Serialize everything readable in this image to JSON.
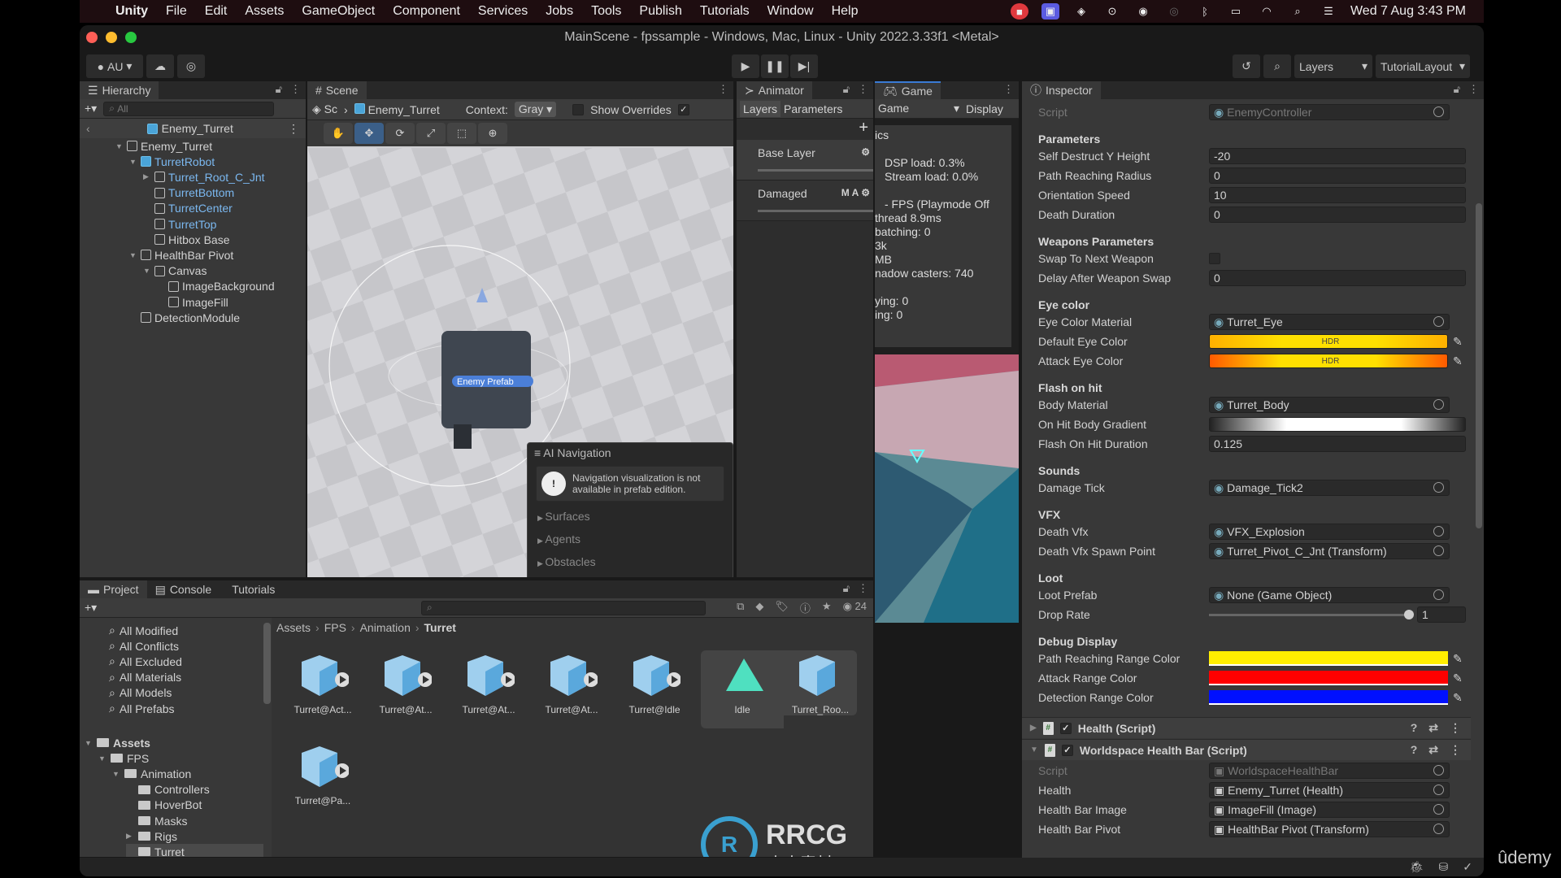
{
  "menubar": {
    "app": "Unity",
    "items": [
      "File",
      "Edit",
      "Assets",
      "GameObject",
      "Component",
      "Services",
      "Jobs",
      "Tools",
      "Publish",
      "Tutorials",
      "Window",
      "Help"
    ],
    "clock": "Wed 7 Aug  3:43 PM"
  },
  "window": {
    "title": "MainScene - fpssample - Windows, Mac, Linux - Unity 2022.3.33f1 <Metal>"
  },
  "toolbar": {
    "account": "AU",
    "layers": "Layers",
    "layout": "TutorialLayout"
  },
  "hierarchy": {
    "tab": "Hierarchy",
    "search_placeholder": "All",
    "prefab_root": "Enemy_Turret",
    "items": [
      {
        "label": "Enemy_Turret",
        "depth": 0,
        "expanded": true,
        "blue": false
      },
      {
        "label": "TurretRobot",
        "depth": 1,
        "expanded": true,
        "blue": true
      },
      {
        "label": "Turret_Root_C_Jnt",
        "depth": 2,
        "expanded": false,
        "blue": true,
        "arrow": true
      },
      {
        "label": "TurretBottom",
        "depth": 2,
        "blue": true
      },
      {
        "label": "TurretCenter",
        "depth": 2,
        "blue": true
      },
      {
        "label": "TurretTop",
        "depth": 2,
        "blue": true
      },
      {
        "label": "Hitbox Base",
        "depth": 2,
        "blue": false
      },
      {
        "label": "HealthBar Pivot",
        "depth": 1,
        "expanded": true,
        "blue": false
      },
      {
        "label": "Canvas",
        "depth": 2,
        "expanded": true,
        "blue": false
      },
      {
        "label": "ImageBackground",
        "depth": 3,
        "blue": false
      },
      {
        "label": "ImageFill",
        "depth": 3,
        "blue": false
      },
      {
        "label": "DetectionModule",
        "depth": 1,
        "blue": false
      }
    ]
  },
  "scene": {
    "tab": "Scene",
    "breadcrumb_root": "Sc",
    "breadcrumb_item": "Enemy_Turret",
    "context_label": "Context:",
    "context_value": "Gray",
    "show_overrides": "Show Overrides",
    "prefab_label": "Enemy Prefab",
    "ai_nav": {
      "title": "AI Navigation",
      "message": "Navigation visualization is not available in prefab edition.",
      "items": [
        "Surfaces",
        "Agents",
        "Obstacles"
      ]
    }
  },
  "animator": {
    "tab": "Animator",
    "subtabs": [
      "Layers",
      "Parameters"
    ],
    "layers": [
      {
        "name": "Base Layer",
        "badges": ""
      },
      {
        "name": "Damaged",
        "badges": "M A"
      }
    ]
  },
  "game": {
    "tab": "Game",
    "display_select": "Game",
    "display": "Display",
    "stats": [
      "ics",
      "",
      "DSP load: 0.3%",
      "Stream load: 0.0%",
      "",
      "- FPS (Playmode Off",
      "thread 8.9ms",
      "batching: 0",
      "3k",
      "MB",
      "nadow casters: 740",
      "",
      "ying: 0",
      "ing: 0"
    ]
  },
  "inspector": {
    "tab": "Inspector",
    "sections": [
      {
        "header": "",
        "rows": [
          {
            "label": "Script",
            "type": "object",
            "value": "EnemyController",
            "dim": true
          }
        ]
      },
      {
        "header": "Parameters",
        "rows": [
          {
            "label": "Self Destruct Y Height",
            "type": "text",
            "value": "-20"
          },
          {
            "label": "Path Reaching Radius",
            "type": "text",
            "value": "0"
          },
          {
            "label": "Orientation Speed",
            "type": "text",
            "value": "10"
          },
          {
            "label": "Death Duration",
            "type": "text",
            "value": "0"
          }
        ]
      },
      {
        "header": "Weapons Parameters",
        "rows": [
          {
            "label": "Swap To Next Weapon",
            "type": "checkbox",
            "value": false
          },
          {
            "label": "Delay After Weapon Swap",
            "type": "text",
            "value": "0"
          }
        ]
      },
      {
        "header": "Eye color",
        "rows": [
          {
            "label": "Eye Color Material",
            "type": "object",
            "value": "Turret_Eye"
          },
          {
            "label": "Default Eye Color",
            "type": "hdr",
            "value": "HDR",
            "color": "#ffb000"
          },
          {
            "label": "Attack Eye Color",
            "type": "hdr",
            "value": "HDR",
            "color": "#ff5a00"
          }
        ]
      },
      {
        "header": "Flash on hit",
        "rows": [
          {
            "label": "Body Material",
            "type": "object",
            "value": "Turret_Body"
          },
          {
            "label": "On Hit Body Gradient",
            "type": "gradient"
          },
          {
            "label": "Flash On Hit Duration",
            "type": "text",
            "value": "0.125"
          }
        ]
      },
      {
        "header": "Sounds",
        "rows": [
          {
            "label": "Damage Tick",
            "type": "object",
            "value": "Damage_Tick2"
          }
        ]
      },
      {
        "header": "VFX",
        "rows": [
          {
            "label": "Death Vfx",
            "type": "object",
            "value": "VFX_Explosion"
          },
          {
            "label": "Death Vfx Spawn Point",
            "type": "object",
            "value": "Turret_Pivot_C_Jnt (Transform)"
          }
        ]
      },
      {
        "header": "Loot",
        "rows": [
          {
            "label": "Loot Prefab",
            "type": "object",
            "value": "None (Game Object)"
          },
          {
            "label": "Drop Rate",
            "type": "slider",
            "value": "1",
            "fraction": 1
          }
        ]
      },
      {
        "header": "Debug Display",
        "rows": [
          {
            "label": "Path Reaching Range Color",
            "type": "color",
            "color": "#ffee00"
          },
          {
            "label": "Attack Range Color",
            "type": "color",
            "color": "#ff0000"
          },
          {
            "label": "Detection Range Color",
            "type": "color",
            "color": "#0010ff"
          }
        ]
      }
    ],
    "components": [
      {
        "name": "Health (Script)",
        "expanded": false
      },
      {
        "name": "Worldspace Health Bar (Script)",
        "expanded": true
      }
    ],
    "healthbar_rows": [
      {
        "label": "Script",
        "value": "WorldspaceHealthBar",
        "dim": true
      },
      {
        "label": "Health",
        "value": "Enemy_Turret (Health)"
      },
      {
        "label": "Health Bar Image",
        "value": "ImageFill (Image)"
      },
      {
        "label": "Health Bar Pivot",
        "value": "HealthBar Pivot (Transform)"
      }
    ]
  },
  "project": {
    "tabs": [
      "Project",
      "Console",
      "Tutorials"
    ],
    "count": "24",
    "favorites": [
      "All Modified",
      "All Conflicts",
      "All Excluded",
      "All Materials",
      "All Models",
      "All Prefabs"
    ],
    "tree": [
      {
        "label": "Assets",
        "depth": 0
      },
      {
        "label": "FPS",
        "depth": 1
      },
      {
        "label": "Animation",
        "depth": 2
      },
      {
        "label": "Controllers",
        "depth": 3
      },
      {
        "label": "HoverBot",
        "depth": 3
      },
      {
        "label": "Masks",
        "depth": 3
      },
      {
        "label": "Rigs",
        "depth": 3
      },
      {
        "label": "Turret",
        "depth": 3,
        "selected": true
      }
    ],
    "breadcrumb": [
      "Assets",
      "FPS",
      "Animation",
      "Turret"
    ],
    "assets": [
      "Turret@Act...",
      "Turret@At...",
      "Turret@At...",
      "Turret@At...",
      "Turret@Idle",
      "Idle",
      "Turret_Roo...",
      "Turret@Pa..."
    ]
  },
  "watermark": {
    "brand": "RRCG",
    "sub": "人人素材",
    "udemy": "ûdemy"
  }
}
